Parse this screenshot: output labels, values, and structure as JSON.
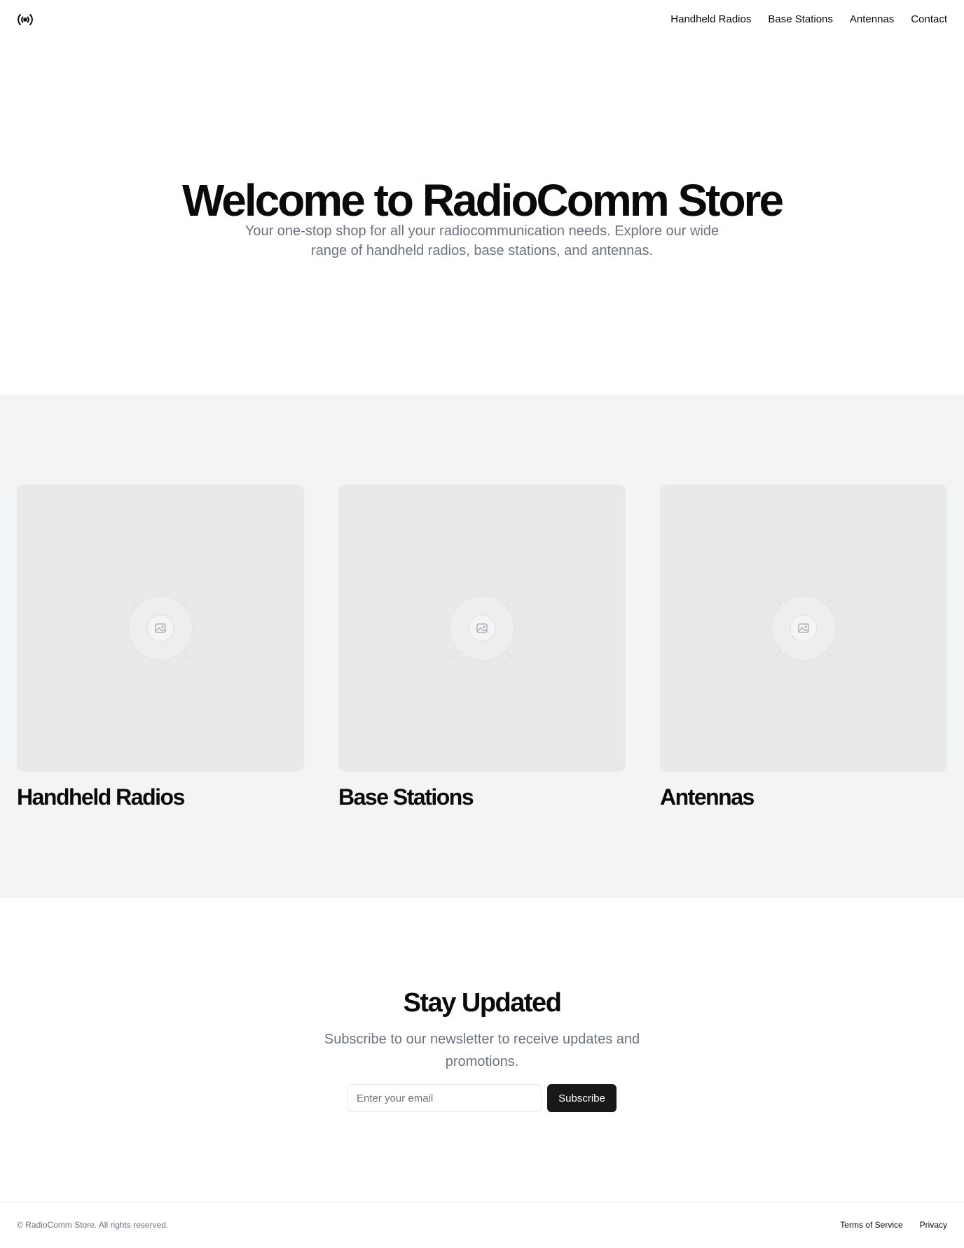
{
  "header": {
    "logo_icon": "radio-broadcast-icon",
    "nav": [
      {
        "label": "Handheld Radios"
      },
      {
        "label": "Base Stations"
      },
      {
        "label": "Antennas"
      },
      {
        "label": "Contact"
      }
    ]
  },
  "hero": {
    "title": "Welcome to RadioComm Store",
    "subtitle": "Your one-stop shop for all your radiocommunication needs. Explore our wide range of handheld radios, base stations, and antennas."
  },
  "categories": [
    {
      "title": "Handheld Radios",
      "image_icon": "image-placeholder-icon"
    },
    {
      "title": "Base Stations",
      "image_icon": "image-placeholder-icon"
    },
    {
      "title": "Antennas",
      "image_icon": "image-placeholder-icon"
    }
  ],
  "newsletter": {
    "title": "Stay Updated",
    "subtitle": "Subscribe to our newsletter to receive updates and promotions.",
    "email_placeholder": "Enter your email",
    "email_value": "",
    "button_label": "Subscribe"
  },
  "footer": {
    "copyright": "© RadioComm Store. All rights reserved.",
    "links": [
      {
        "label": "Terms of Service"
      },
      {
        "label": "Privacy"
      }
    ]
  },
  "colors": {
    "text": "#0a0a0a",
    "muted": "#6b7280",
    "section_bg": "#f3f4f6",
    "placeholder_bg": "#e9e9e9",
    "button_bg": "#18181b"
  }
}
